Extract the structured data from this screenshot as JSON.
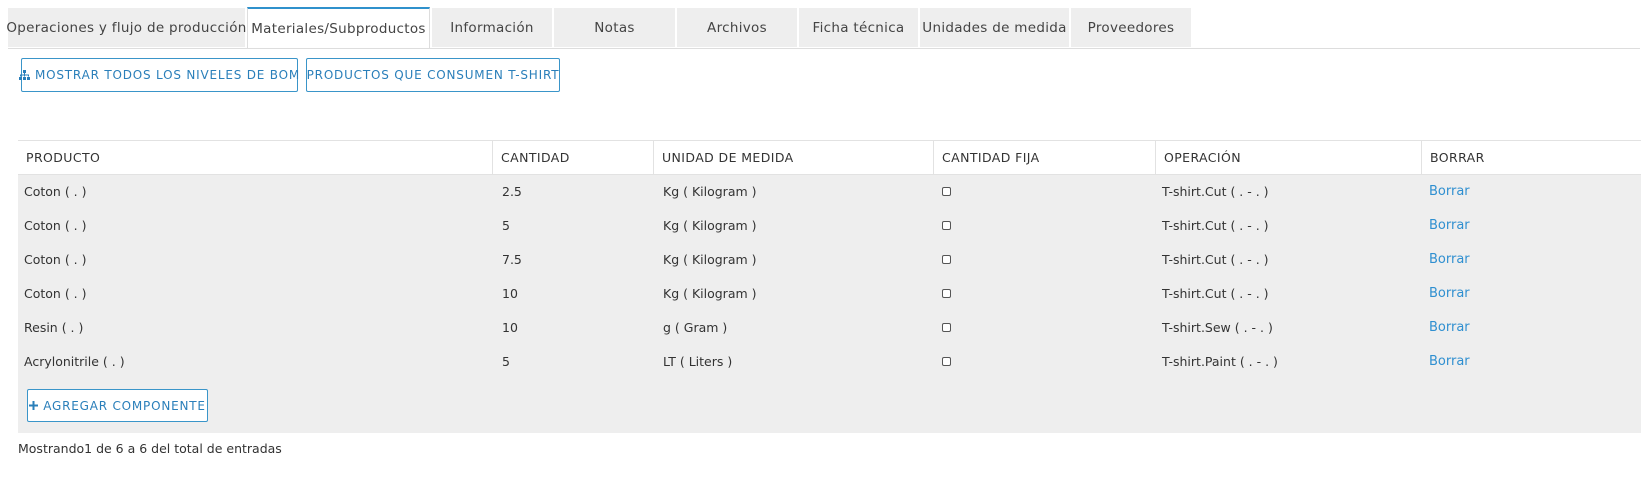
{
  "tabs": [
    {
      "label": "Operaciones y flujo de producción"
    },
    {
      "label": "Materiales/Subproductos"
    },
    {
      "label": "Información"
    },
    {
      "label": "Notas"
    },
    {
      "label": "Archivos"
    },
    {
      "label": "Ficha técnica"
    },
    {
      "label": "Unidades de medida"
    },
    {
      "label": "Proveedores"
    }
  ],
  "active_tab": "Materiales/Subproductos",
  "toolbar": {
    "show_bom_label": "MOSTRAR TODOS LOS NIVELES DE BOM",
    "consumers_label": "PRODUCTOS QUE CONSUMEN T-SHIRT"
  },
  "table": {
    "headers": {
      "product": "PRODUCTO",
      "quantity": "CANTIDAD",
      "unit": "UNIDAD DE MEDIDA",
      "fixed": "CANTIDAD FIJA",
      "operation": "OPERACIÓN",
      "delete": "BORRAR"
    },
    "rows": [
      {
        "product": "Coton ( . )",
        "quantity": "2.5",
        "unit": "Kg ( Kilogram )",
        "fixed": false,
        "operation": "T-shirt.Cut ( . - . )",
        "delete": "Borrar"
      },
      {
        "product": "Coton ( . )",
        "quantity": "5",
        "unit": "Kg ( Kilogram )",
        "fixed": false,
        "operation": "T-shirt.Cut ( . - . )",
        "delete": "Borrar"
      },
      {
        "product": "Coton ( . )",
        "quantity": "7.5",
        "unit": "Kg ( Kilogram )",
        "fixed": false,
        "operation": "T-shirt.Cut ( . - . )",
        "delete": "Borrar"
      },
      {
        "product": "Coton ( . )",
        "quantity": "10",
        "unit": "Kg ( Kilogram )",
        "fixed": false,
        "operation": "T-shirt.Cut ( . - . )",
        "delete": "Borrar"
      },
      {
        "product": "Resin ( . )",
        "quantity": "10",
        "unit": "g ( Gram )",
        "fixed": false,
        "operation": "T-shirt.Sew ( . - . )",
        "delete": "Borrar"
      },
      {
        "product": "Acrylonitrile ( . )",
        "quantity": "5",
        "unit": "LT ( Liters )",
        "fixed": false,
        "operation": "T-shirt.Paint ( . - . )",
        "delete": "Borrar"
      }
    ],
    "add_label": "AGREGAR COMPONENTE"
  },
  "footer": {
    "summary": "Mostrando1 de 6 a 6 del total de entradas"
  },
  "icons": {
    "bom": "sitemap-icon",
    "add": "plus-icon"
  },
  "colors": {
    "accent": "#2f91cc",
    "link": "#2f8fd0",
    "table_bg": "#eeeeee",
    "tab_bg": "#eeeeee"
  }
}
